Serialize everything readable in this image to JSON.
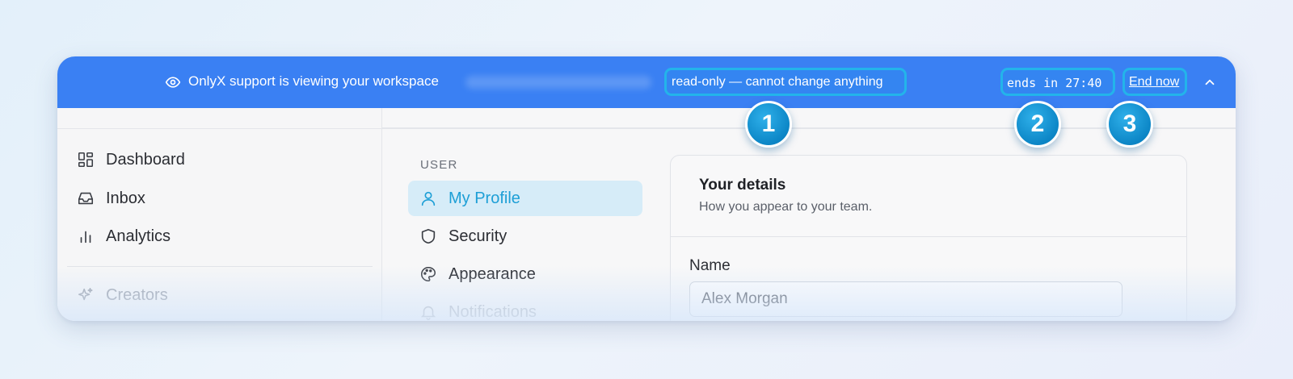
{
  "banner": {
    "message": "OnlyX support is viewing your workspace",
    "readonly_note": "read-only — cannot change anything",
    "timer": "ends in 27:40",
    "end_label": "End now",
    "color": "#3a80f3"
  },
  "callouts": [
    "1",
    "2",
    "3"
  ],
  "sidebar": {
    "items": [
      {
        "label": "Dashboard",
        "icon": "dashboard-grid-icon"
      },
      {
        "label": "Inbox",
        "icon": "inbox-tray-icon"
      },
      {
        "label": "Analytics",
        "icon": "bar-chart-icon"
      },
      {
        "label": "Creators",
        "icon": "sparkle-icon"
      }
    ]
  },
  "settings_nav": {
    "section": "USER",
    "items": [
      {
        "label": "My Profile",
        "icon": "user-icon",
        "active": true
      },
      {
        "label": "Security",
        "icon": "shield-icon"
      },
      {
        "label": "Appearance",
        "icon": "palette-icon"
      },
      {
        "label": "Notifications",
        "icon": "bell-icon"
      }
    ]
  },
  "details": {
    "title": "Your details",
    "subtitle": "How you appear to your team.",
    "name_label": "Name",
    "name_value": "Alex Morgan"
  },
  "colors": {
    "accent": "#1d9fd6",
    "highlight": "#23b4ea",
    "badge": "#0c86c6"
  }
}
